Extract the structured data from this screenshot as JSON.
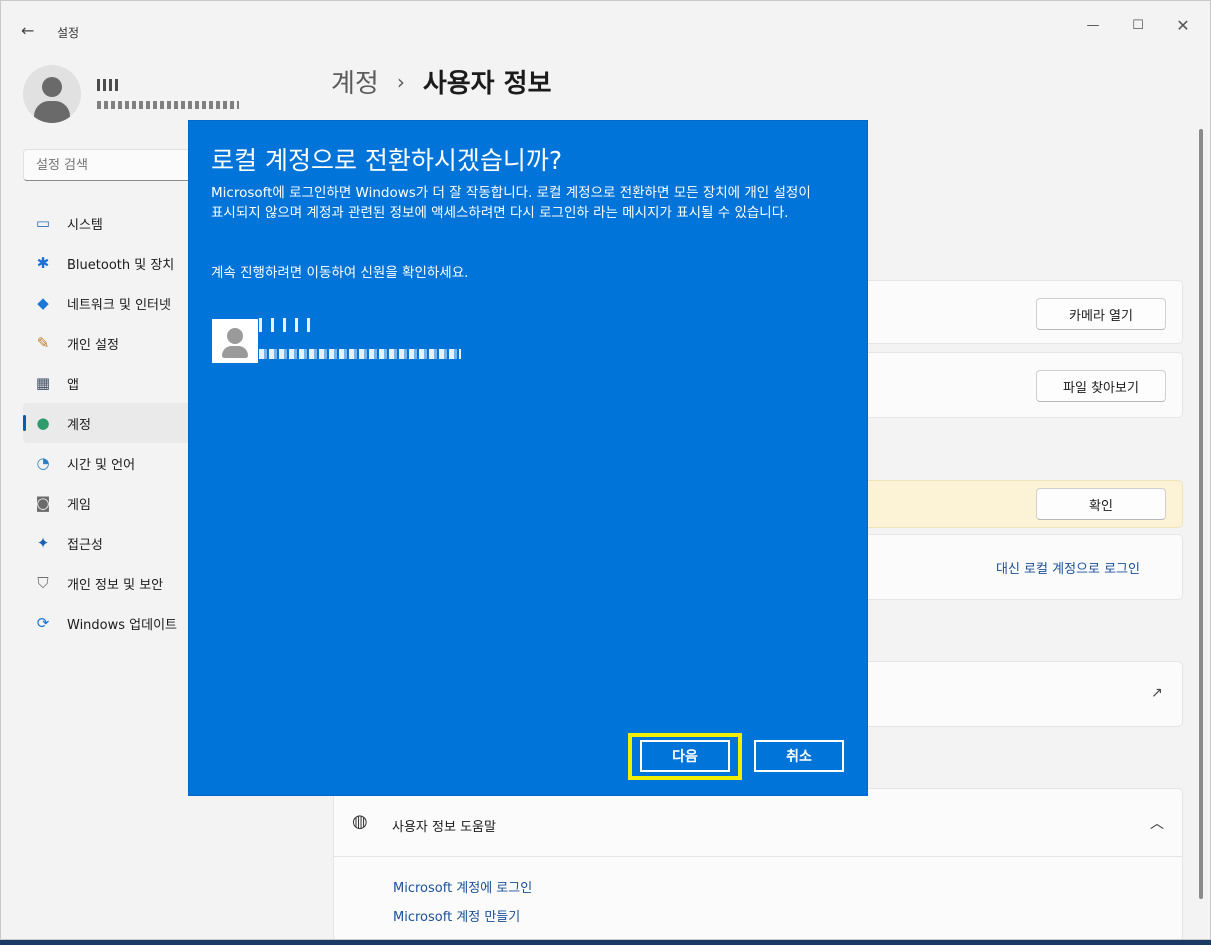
{
  "window": {
    "title": "설정",
    "back_icon": "back-arrow-icon",
    "controls": {
      "minimize": "—",
      "maximize": "☐",
      "close": "✕"
    }
  },
  "profile": {
    "name": "U",
    "email": ""
  },
  "search": {
    "placeholder": "설정 검색"
  },
  "sidebar": {
    "items": [
      {
        "label": "시스템",
        "icon": "system-icon",
        "glyph": "▭",
        "color": "#2f6fb3"
      },
      {
        "label": "Bluetooth 및 장치",
        "icon": "bluetooth-icon",
        "glyph": "✱",
        "color": "#1d6fd6"
      },
      {
        "label": "네트워크 및 인터넷",
        "icon": "wifi-icon",
        "glyph": "◆",
        "color": "#1e77d4"
      },
      {
        "label": "개인 설정",
        "icon": "brush-icon",
        "glyph": "✎",
        "color": "#c07a2b"
      },
      {
        "label": "앱",
        "icon": "apps-icon",
        "glyph": "▦",
        "color": "#3f4f63"
      },
      {
        "label": "계정",
        "icon": "account-icon",
        "glyph": "●",
        "color": "#2e9b6b"
      },
      {
        "label": "시간 및 언어",
        "icon": "globe-clock-icon",
        "glyph": "◔",
        "color": "#2b7fc7"
      },
      {
        "label": "게임",
        "icon": "gamepad-icon",
        "glyph": "◙",
        "color": "#6b6b6b"
      },
      {
        "label": "접근성",
        "icon": "accessibility-icon",
        "glyph": "✦",
        "color": "#1c5fb0"
      },
      {
        "label": "개인 정보 및 보안",
        "icon": "shield-icon",
        "glyph": "⛉",
        "color": "#6e6e6e"
      },
      {
        "label": "Windows 업데이트",
        "icon": "update-icon",
        "glyph": "⟳",
        "color": "#1d74cf"
      }
    ],
    "active_index": 5
  },
  "breadcrumb": {
    "parent": "계정",
    "separator": "›",
    "current": "사용자 정보"
  },
  "main": {
    "camera_button": "카메라 열기",
    "browse_button": "파일 찾아보기",
    "confirm_button": "확인",
    "local_account_link": "대신 로컬 계정으로 로그인",
    "external_link_icon": "external-link-icon",
    "help": {
      "title": "사용자 정보 도움말",
      "icon": "globe-icon",
      "links": [
        "Microsoft 계정에 로그인",
        "Microsoft 계정 만들기"
      ]
    }
  },
  "dialog": {
    "title": "로컬 계정으로 전환하시겠습니까?",
    "body": "Microsoft에 로그인하면 Windows가 더 잘 작동합니다. 로컬 계정으로 전환하면 모든 장치에 개인 설정이 표시되지 않으며 계정과 관련된 정보에 액세스하려면 다시 로그인하 라는 메시지가 표시될 수 있습니다.",
    "body2": "계속 진행하려면 이동하여 신원을 확인하세요.",
    "next_button": "다음",
    "cancel_button": "취소",
    "highlight_color": "#f2ee00",
    "accent_color": "#0074d9"
  }
}
